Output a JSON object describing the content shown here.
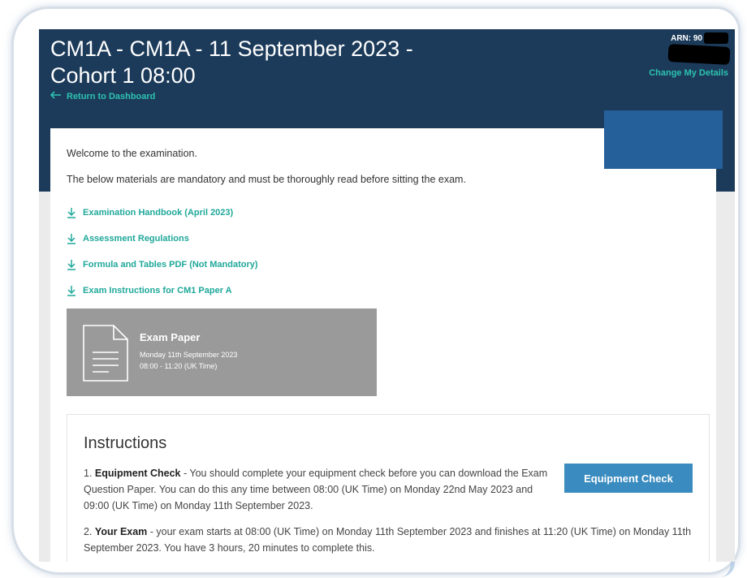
{
  "header": {
    "title": "CM1A - CM1A - 11 September 2023 - Cohort 1 08:00",
    "back_link": "Return to Dashboard",
    "arn": "ARN: 90",
    "change_details": "Change My Details",
    "bg_color": "#1c3b5a",
    "accent_color": "#2dc2b0"
  },
  "main": {
    "welcome": "Welcome to the examination.",
    "mandatory_note": "The below materials are mandatory and must be thoroughly read before sitting the exam.",
    "downloads": [
      {
        "label": "Examination Handbook (April 2023)",
        "icon": "download-icon"
      },
      {
        "label": "Assessment Regulations",
        "icon": "download-icon"
      },
      {
        "label": "Formula and Tables PDF (Not Mandatory)",
        "icon": "download-icon"
      },
      {
        "label": "Exam Instructions for CM1 Paper A",
        "icon": "download-icon"
      }
    ],
    "exam_tile": {
      "title": "Exam Paper",
      "date": "Monday 11th September 2023",
      "time": "08:00 - 11:20 (UK Time)",
      "icon": "document-icon"
    }
  },
  "instructions": {
    "heading": "Instructions",
    "items": [
      {
        "prefix": "1.",
        "bold": "Equipment Check",
        "text": " - You should complete your equipment check before you can download the Exam Question Paper. You can do this any time between 08:00 (UK Time) on Monday 22nd May 2023 and 09:00 (UK Time) on Monday 11th September 2023."
      },
      {
        "prefix": "2.",
        "bold": "Your Exam",
        "text": " - your exam starts at 08:00 (UK Time) on Monday 11th September 2023 and finishes at 11:20 (UK Time) on Monday 11th September 2023. You have 3 hours, 20 minutes to complete this."
      }
    ],
    "equipment_button": "Equipment Check",
    "button_color": "#3a8bbf"
  }
}
